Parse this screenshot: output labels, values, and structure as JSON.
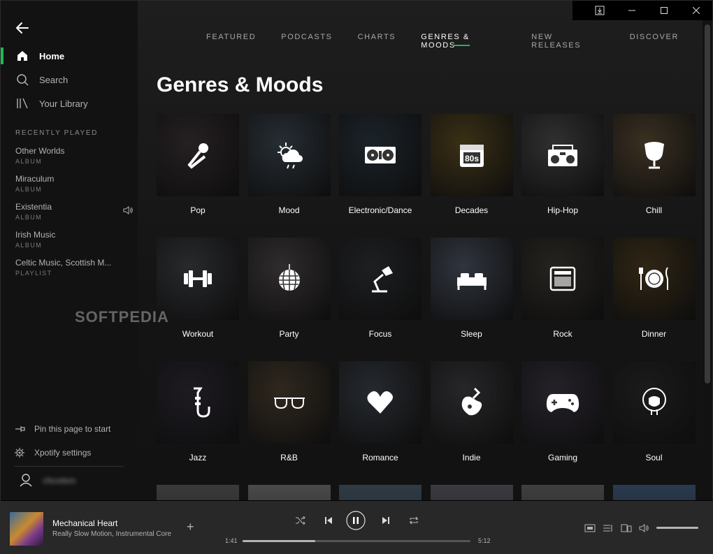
{
  "window": {
    "controls": [
      "download-icon",
      "minimize-icon",
      "maximize-icon",
      "close-icon"
    ]
  },
  "sidebar": {
    "nav": [
      {
        "label": "Home",
        "icon": "home-icon",
        "active": true
      },
      {
        "label": "Search",
        "icon": "search-icon",
        "active": false
      },
      {
        "label": "Your Library",
        "icon": "library-icon",
        "active": false
      }
    ],
    "recent_title": "RECENTLY PLAYED",
    "recent": [
      {
        "name": "Other Worlds",
        "type": "ALBUM"
      },
      {
        "name": "Miraculum",
        "type": "ALBUM"
      },
      {
        "name": "Existentia",
        "type": "ALBUM",
        "playing": true
      },
      {
        "name": "Irish Music",
        "type": "ALBUM"
      },
      {
        "name": "Celtic Music, Scottish M...",
        "type": "PLAYLIST"
      }
    ],
    "footer": {
      "pin_label": "Pin this page to start",
      "settings_label": "Xpotify settings",
      "username": "cfxcelem"
    }
  },
  "main": {
    "tabs": [
      "FEATURED",
      "PODCASTS",
      "CHARTS",
      "GENRES & MOODS",
      "NEW RELEASES",
      "DISCOVER"
    ],
    "active_tab": "GENRES & MOODS",
    "title": "Genres & Moods",
    "categories": [
      {
        "label": "Pop",
        "icon": "microphone-icon",
        "bg": "#3a3236"
      },
      {
        "label": "Mood",
        "icon": "weather-icon",
        "bg": "#3b4650"
      },
      {
        "label": "Electronic/Dance",
        "icon": "turntable-icon",
        "bg": "#2a3640"
      },
      {
        "label": "Decades",
        "icon": "calendar-80s-icon",
        "bg": "#5a4a22"
      },
      {
        "label": "Hip-Hop",
        "icon": "boombox-icon",
        "bg": "#4a4a4a"
      },
      {
        "label": "Chill",
        "icon": "egg-chair-icon",
        "bg": "#5a4a34"
      },
      {
        "label": "Workout",
        "icon": "dumbbell-icon",
        "bg": "#3e4044"
      },
      {
        "label": "Party",
        "icon": "disco-ball-icon",
        "bg": "#4a4448"
      },
      {
        "label": "Focus",
        "icon": "desk-lamp-icon",
        "bg": "#2e3034"
      },
      {
        "label": "Sleep",
        "icon": "bed-icon",
        "bg": "#4a5260"
      },
      {
        "label": "Rock",
        "icon": "amplifier-icon",
        "bg": "#3a3630"
      },
      {
        "label": "Dinner",
        "icon": "plate-cutlery-icon",
        "bg": "#4a3a20"
      },
      {
        "label": "Jazz",
        "icon": "saxophone-icon",
        "bg": "#2e2a34"
      },
      {
        "label": "R&B",
        "icon": "sunglasses-icon",
        "bg": "#4a3e30"
      },
      {
        "label": "Romance",
        "icon": "heart-icon",
        "bg": "#3a4048"
      },
      {
        "label": "Indie",
        "icon": "guitar-icon",
        "bg": "#3c3c40"
      },
      {
        "label": "Gaming",
        "icon": "gamepad-icon",
        "bg": "#3a3440"
      },
      {
        "label": "Soul",
        "icon": "afro-woman-icon",
        "bg": "#2a2a2a"
      }
    ],
    "partial_row_bgs": [
      "#3a3a3a",
      "#4a4a4a",
      "#2f3b45",
      "#3a3a40",
      "#3f3f3f",
      "#2a3a50"
    ]
  },
  "watermark": "SOFTPEDIA",
  "player": {
    "track": "Mechanical Heart",
    "artist": "Really Slow Motion, Instrumental Core",
    "elapsed": "1:41",
    "duration": "5:12",
    "progress": 0.32,
    "volume": 1.0
  },
  "colors": {
    "accent": "#1db954",
    "bg": "#121212",
    "player_bg": "#282828"
  }
}
